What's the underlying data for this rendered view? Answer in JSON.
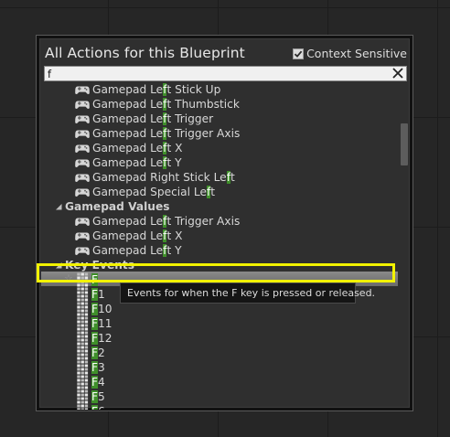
{
  "title": "All Actions for this Blueprint",
  "context_sensitive": {
    "label": "Context Sensitive",
    "checked": true
  },
  "search": {
    "value": "f",
    "placeholder": ""
  },
  "list": {
    "rows": [
      {
        "kind": "gamepad",
        "pre": "Gamepad Le",
        "hl": "f",
        "post": "t Stick Up"
      },
      {
        "kind": "gamepad",
        "pre": "Gamepad Le",
        "hl": "f",
        "post": "t Thumbstick"
      },
      {
        "kind": "gamepad",
        "pre": "Gamepad Le",
        "hl": "f",
        "post": "t Trigger"
      },
      {
        "kind": "gamepad",
        "pre": "Gamepad Le",
        "hl": "f",
        "post": "t Trigger Axis"
      },
      {
        "kind": "gamepad",
        "pre": "Gamepad Le",
        "hl": "f",
        "post": "t X"
      },
      {
        "kind": "gamepad",
        "pre": "Gamepad Le",
        "hl": "f",
        "post": "t Y"
      },
      {
        "kind": "gamepad",
        "pre": "Gamepad Right Stick Le",
        "hl": "f",
        "post": "t"
      },
      {
        "kind": "gamepad",
        "pre": "Gamepad Special Le",
        "hl": "f",
        "post": "t"
      },
      {
        "kind": "category",
        "label": "Gamepad Values"
      },
      {
        "kind": "gamepad",
        "pre": "Gamepad Le",
        "hl": "f",
        "post": "t Trigger Axis"
      },
      {
        "kind": "gamepad",
        "pre": "Gamepad Le",
        "hl": "f",
        "post": "t X"
      },
      {
        "kind": "gamepad",
        "pre": "Gamepad Le",
        "hl": "f",
        "post": "t Y"
      },
      {
        "kind": "category",
        "label": "Key Events"
      },
      {
        "kind": "key",
        "pre": "",
        "hl": "F",
        "post": "",
        "selected": true
      },
      {
        "kind": "key",
        "pre": "",
        "hl": "F",
        "post": "1"
      },
      {
        "kind": "key",
        "pre": "",
        "hl": "F",
        "post": "10"
      },
      {
        "kind": "key",
        "pre": "",
        "hl": "F",
        "post": "11"
      },
      {
        "kind": "key",
        "pre": "",
        "hl": "F",
        "post": "12"
      },
      {
        "kind": "key",
        "pre": "",
        "hl": "F",
        "post": "2"
      },
      {
        "kind": "key",
        "pre": "",
        "hl": "F",
        "post": "3"
      },
      {
        "kind": "key",
        "pre": "",
        "hl": "F",
        "post": "4"
      },
      {
        "kind": "key",
        "pre": "",
        "hl": "F",
        "post": "5"
      },
      {
        "kind": "key",
        "pre": "",
        "hl": "F",
        "post": "6"
      }
    ]
  },
  "tooltip": "Events for when the F key is pressed or released.",
  "colors": {
    "match_highlight": "#3f8f2a",
    "selection_outline": "#f2f200",
    "panel_bg": "#2f2f2f"
  },
  "icons": {
    "gamepad": "gamepad-icon",
    "key_event": "keyboard-icon",
    "collapse": "collapse-triangle-icon",
    "clear": "close-icon",
    "checkbox": "checkmark-icon"
  }
}
